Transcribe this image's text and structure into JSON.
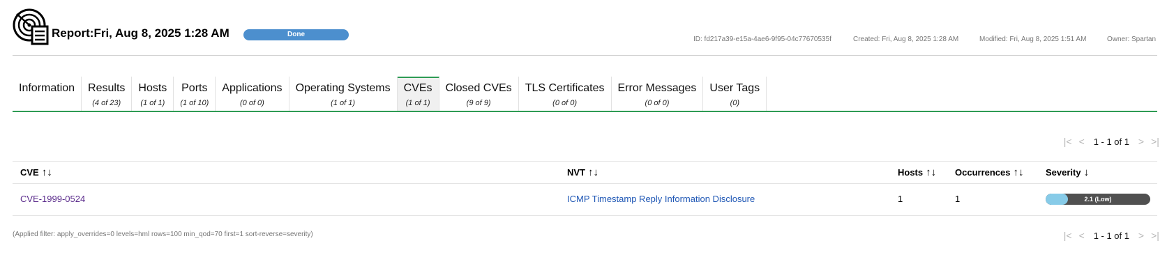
{
  "header": {
    "title": "Report:Fri, Aug 8, 2025 1:28 AM",
    "status": "Done",
    "status_progress": 1.0,
    "status_color": "#4c8fce",
    "id": "ID: fd217a39-e15a-4ae6-9f95-04c77670535f",
    "created": "Created: Fri, Aug 8, 2025 1:28 AM",
    "modified": "Modified: Fri, Aug 8, 2025 1:51 AM",
    "owner": "Owner: Spartan",
    "icon": "report-icon"
  },
  "tabs": [
    {
      "label": "Information",
      "count": ""
    },
    {
      "label": "Results",
      "count": "(4 of 23)"
    },
    {
      "label": "Hosts",
      "count": "(1 of 1)"
    },
    {
      "label": "Ports",
      "count": "(1 of 10)"
    },
    {
      "label": "Applications",
      "count": "(0 of 0)"
    },
    {
      "label": "Operating Systems",
      "count": "(1 of 1)"
    },
    {
      "label": "CVEs",
      "count": "(1 of 1)",
      "active": true
    },
    {
      "label": "Closed CVEs",
      "count": "(9 of 9)"
    },
    {
      "label": "TLS Certificates",
      "count": "(0 of 0)"
    },
    {
      "label": "Error Messages",
      "count": "(0 of 0)"
    },
    {
      "label": "User Tags",
      "count": "(0)"
    }
  ],
  "accent_color": "#2e9b54",
  "pagination": {
    "text": "1 - 1 of 1",
    "first_icon": "first-page-icon",
    "prev_icon": "previous-page-icon",
    "next_icon": "next-page-icon",
    "last_icon": "last-page-icon"
  },
  "table": {
    "columns": [
      {
        "label": "CVE",
        "sort_icon": "↑↓"
      },
      {
        "label": "NVT",
        "sort_icon": "↑↓"
      },
      {
        "label": "Hosts",
        "sort_icon": "↑↓"
      },
      {
        "label": "Occurrences",
        "sort_icon": "↑↓"
      },
      {
        "label": "Severity",
        "sort_icon": "↓"
      }
    ],
    "rows": [
      {
        "cve": "CVE-1999-0524",
        "nvt": "ICMP Timestamp Reply Information Disclosure",
        "hosts": "1",
        "occurrences": "1",
        "severity_label": "2.1 (Low)",
        "severity_value": 2.1,
        "severity_max": 10,
        "severity_color": "#87cbe8"
      }
    ]
  },
  "filter": "(Applied filter: apply_overrides=0 levels=hml rows=100 min_qod=70 first=1 sort-reverse=severity)"
}
